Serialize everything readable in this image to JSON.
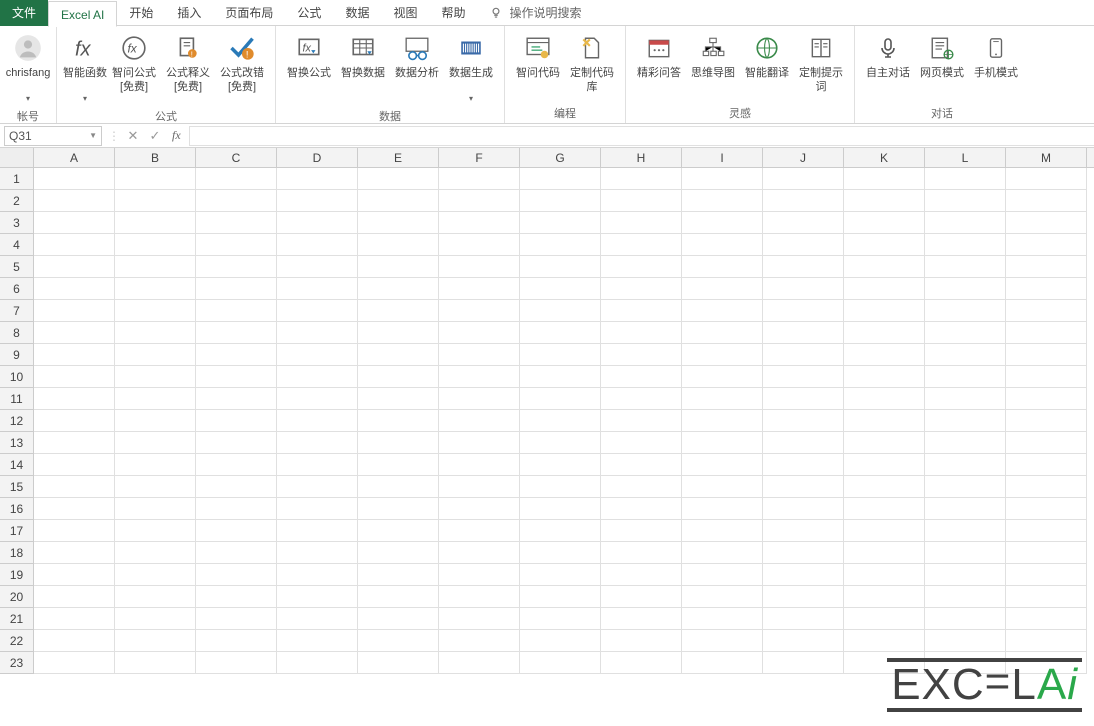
{
  "tabs": {
    "file": "文件",
    "items": [
      "Excel AI",
      "开始",
      "插入",
      "页面布局",
      "公式",
      "数据",
      "视图",
      "帮助"
    ],
    "active_index": 0,
    "search_hint": "操作说明搜索"
  },
  "ribbon": {
    "groups": [
      {
        "label": "帐号",
        "items": [
          {
            "id": "account",
            "label1": "chrisfang",
            "label2": ""
          }
        ]
      },
      {
        "label": "公式",
        "items": [
          {
            "id": "smart-fn",
            "label1": "智能函数",
            "label2": ""
          },
          {
            "id": "ask-formula",
            "label1": "智问公式",
            "label2": "[免费]"
          },
          {
            "id": "explain-formula",
            "label1": "公式释义",
            "label2": "[免费]"
          },
          {
            "id": "fix-formula",
            "label1": "公式改错",
            "label2": "[免费]"
          }
        ]
      },
      {
        "label": "数据",
        "items": [
          {
            "id": "swap-formula",
            "label1": "智换公式",
            "label2": ""
          },
          {
            "id": "swap-data",
            "label1": "智换数据",
            "label2": ""
          },
          {
            "id": "analyze",
            "label1": "数据分析",
            "label2": ""
          },
          {
            "id": "gen-data",
            "label1": "数据生成",
            "label2": ""
          }
        ]
      },
      {
        "label": "编程",
        "items": [
          {
            "id": "ask-code",
            "label1": "智问代码",
            "label2": ""
          },
          {
            "id": "custom-lib",
            "label1": "定制代码库",
            "label2": ""
          }
        ]
      },
      {
        "label": "灵感",
        "items": [
          {
            "id": "jingcai",
            "label1": "精彩问答",
            "label2": ""
          },
          {
            "id": "mindmap",
            "label1": "思维导图",
            "label2": ""
          },
          {
            "id": "translate",
            "label1": "智能翻译",
            "label2": ""
          },
          {
            "id": "prompt",
            "label1": "定制提示词",
            "label2": ""
          }
        ]
      },
      {
        "label": "对话",
        "items": [
          {
            "id": "auto-chat",
            "label1": "自主对话",
            "label2": ""
          },
          {
            "id": "web-mode",
            "label1": "网页模式",
            "label2": ""
          },
          {
            "id": "mobile-mode",
            "label1": "手机模式",
            "label2": ""
          }
        ]
      }
    ]
  },
  "formula_bar": {
    "cell_ref": "Q31",
    "value": ""
  },
  "grid": {
    "columns": [
      "A",
      "B",
      "C",
      "D",
      "E",
      "F",
      "G",
      "H",
      "I",
      "J",
      "K",
      "L",
      "M"
    ],
    "row_count": 23
  },
  "watermark": {
    "text1": "EXC",
    "text2": "L",
    "text3": "A",
    "text4": "i"
  }
}
